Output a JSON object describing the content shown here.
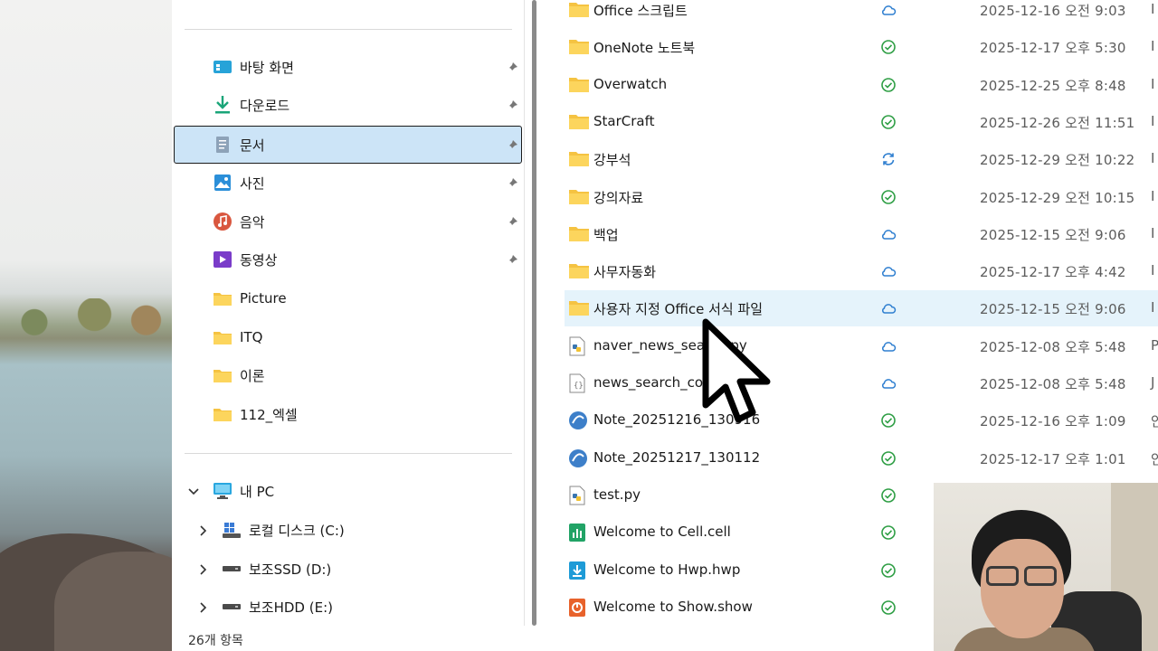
{
  "status_bar": {
    "item_count": "26개 항목"
  },
  "nav": {
    "quick_access": [
      {
        "label": "바탕 화면",
        "icon": "desktop-icon",
        "pinned": true
      },
      {
        "label": "다운로드",
        "icon": "download-icon",
        "pinned": true
      },
      {
        "label": "문서",
        "icon": "documents-icon",
        "pinned": true,
        "selected": true
      },
      {
        "label": "사진",
        "icon": "pictures-icon",
        "pinned": true
      },
      {
        "label": "음악",
        "icon": "music-icon",
        "pinned": true
      },
      {
        "label": "동영상",
        "icon": "videos-icon",
        "pinned": true
      },
      {
        "label": "Picture",
        "icon": "folder-icon",
        "pinned": false
      },
      {
        "label": "ITQ",
        "icon": "folder-icon",
        "pinned": false
      },
      {
        "label": "이론",
        "icon": "folder-icon",
        "pinned": false
      },
      {
        "label": "112_엑셀",
        "icon": "folder-icon",
        "pinned": false
      }
    ],
    "this_pc": {
      "label": "내 PC",
      "drives": [
        {
          "label": "로컬 디스크 (C:)",
          "icon": "windows-drive-icon"
        },
        {
          "label": "보조SSD (D:)",
          "icon": "drive-icon"
        },
        {
          "label": "보조HDD (E:)",
          "icon": "drive-icon"
        }
      ]
    }
  },
  "files": [
    {
      "name": "Office 스크립트",
      "icon": "folder",
      "status": "cloud",
      "date": "2025-12-16 오전 9:03",
      "type": "I"
    },
    {
      "name": "OneNote 노트북",
      "icon": "folder",
      "status": "synced",
      "date": "2025-12-17 오후 5:30",
      "type": "I"
    },
    {
      "name": "Overwatch",
      "icon": "folder",
      "status": "synced",
      "date": "2025-12-25 오후 8:48",
      "type": "I"
    },
    {
      "name": "StarCraft",
      "icon": "folder",
      "status": "synced",
      "date": "2025-12-26 오전 11:51",
      "type": "I"
    },
    {
      "name": "강부석",
      "icon": "folder",
      "status": "syncing",
      "date": "2025-12-29 오전 10:22",
      "type": "I"
    },
    {
      "name": "강의자료",
      "icon": "folder",
      "status": "synced",
      "date": "2025-12-29 오전 10:15",
      "type": "I"
    },
    {
      "name": "백업",
      "icon": "folder",
      "status": "cloud",
      "date": "2025-12-15 오전 9:06",
      "type": "I"
    },
    {
      "name": "사무자동화",
      "icon": "folder",
      "status": "cloud",
      "date": "2025-12-17 오후 4:42",
      "type": "I"
    },
    {
      "name": "사용자 지정 Office 서식 파일",
      "icon": "folder",
      "status": "cloud",
      "date": "2025-12-15 오전 9:06",
      "type": "I",
      "hover": true
    },
    {
      "name": "naver_news_search.py",
      "icon": "python",
      "status": "cloud",
      "date": "2025-12-08 오후 5:48",
      "type": "P"
    },
    {
      "name": "news_search_con",
      "icon": "json",
      "status": "cloud",
      "date": "2025-12-08 오후 5:48",
      "type": "J"
    },
    {
      "name": "Note_20251216_130916",
      "icon": "note",
      "status": "synced",
      "date": "2025-12-16 오후 1:09",
      "type": "안"
    },
    {
      "name": "Note_20251217_130112",
      "icon": "note",
      "status": "synced",
      "date": "2025-12-17 오후 1:01",
      "type": "안"
    },
    {
      "name": "test.py",
      "icon": "python",
      "status": "synced",
      "date": "",
      "type": ""
    },
    {
      "name": "Welcome to Cell.cell",
      "icon": "cell",
      "status": "synced",
      "date": "",
      "type": ""
    },
    {
      "name": "Welcome to Hwp.hwp",
      "icon": "hwp",
      "status": "synced",
      "date": "",
      "type": ""
    },
    {
      "name": "Welcome to Show.show",
      "icon": "show",
      "status": "synced",
      "date": "",
      "type": ""
    }
  ],
  "colors": {
    "selection": "#cce4f7",
    "hover": "#e5f3fb",
    "folder": "#f5c342",
    "synced": "#2e9e44",
    "cloud": "#2f7fd0"
  }
}
